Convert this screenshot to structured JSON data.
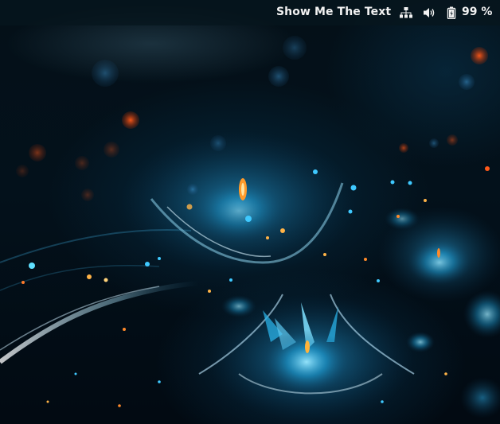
{
  "top_bar": {
    "app_name": "Show Me The Text",
    "network_icon": "network-wired-icon",
    "volume_icon": "volume-icon",
    "battery_icon": "battery-charging-icon",
    "battery_percent": "99 %"
  },
  "wallpaper": {
    "accent_colors": [
      "#1e9fd6",
      "#7fe0ff",
      "#ff6a1a",
      "#03111b"
    ]
  }
}
